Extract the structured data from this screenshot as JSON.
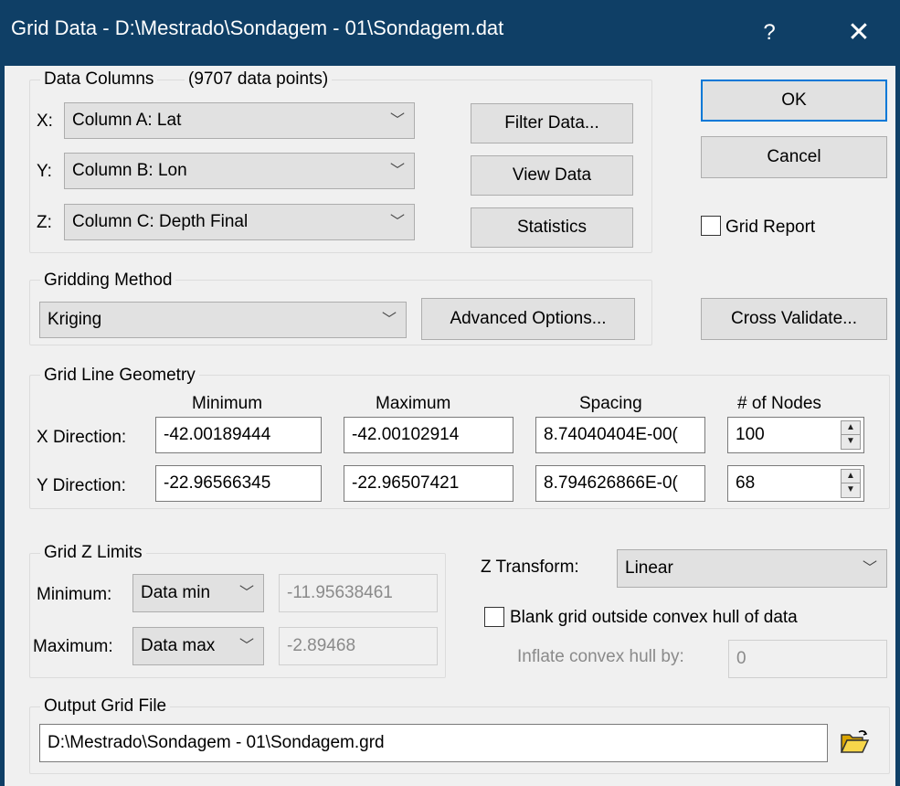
{
  "title": "Grid Data - D:\\Mestrado\\Sondagem - 01\\Sondagem.dat",
  "titlebar": {
    "help": "?",
    "close": "✕"
  },
  "data_columns": {
    "group_label": "Data Columns",
    "count_label": "(9707 data points)",
    "x_label": "X:",
    "x_value": "Column A:  Lat",
    "y_label": "Y:",
    "y_value": "Column B:  Lon",
    "z_label": "Z:",
    "z_value": "Column C:  Depth Final",
    "filter_button": "Filter Data...",
    "view_button": "View Data",
    "stats_button": "Statistics"
  },
  "ok_button": "OK",
  "cancel_button": "Cancel",
  "grid_report_label": "Grid Report",
  "gridding": {
    "group_label": "Gridding Method",
    "method": "Kriging",
    "advanced_button": "Advanced Options..."
  },
  "cross_validate_button": "Cross Validate...",
  "geometry": {
    "group_label": "Grid Line Geometry",
    "headers": {
      "min": "Minimum",
      "max": "Maximum",
      "spacing": "Spacing",
      "nodes": "# of Nodes"
    },
    "x_label": "X Direction:",
    "y_label": "Y Direction:",
    "x": {
      "min": "-42.00189444",
      "max": "-42.00102914",
      "spacing": "8.74040404E-00(",
      "nodes": "100"
    },
    "y": {
      "min": "-22.96566345",
      "max": "-22.96507421",
      "spacing": "8.794626866E-0(",
      "nodes": "68"
    }
  },
  "zlimits": {
    "group_label": "Grid Z Limits",
    "min_label": "Minimum:",
    "min_mode": "Data min",
    "min_value": "-11.95638461",
    "max_label": "Maximum:",
    "max_mode": "Data max",
    "max_value": "-2.89468"
  },
  "ztransform": {
    "label": "Z Transform:",
    "value": "Linear"
  },
  "blank": {
    "label": "Blank grid outside convex hull of data",
    "inflate_label": "Inflate convex hull by:",
    "inflate_value": "0"
  },
  "output": {
    "group_label": "Output Grid File",
    "path": "D:\\Mestrado\\Sondagem - 01\\Sondagem.grd"
  },
  "icons": {
    "folder": "folder-open-icon",
    "chevron": "chevron-down-icon"
  },
  "colors": {
    "titlebar": "#0f3f66",
    "dialog_bg": "#f0f0f0",
    "ok_border": "#0078d7"
  }
}
